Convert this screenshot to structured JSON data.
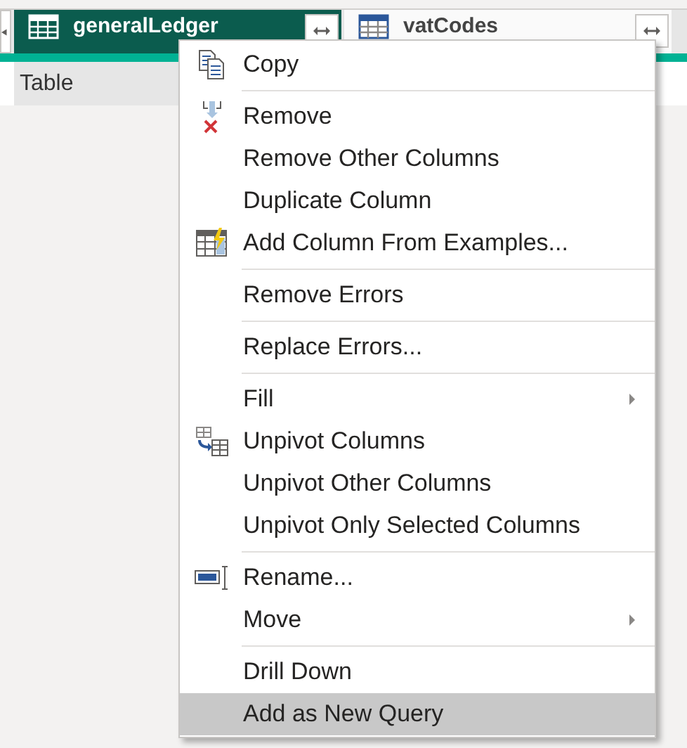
{
  "columns": [
    {
      "title": "generalLedger",
      "selected": true,
      "cell": "Table"
    },
    {
      "title": "vatCodes",
      "selected": false
    }
  ],
  "context_menu": {
    "groups": [
      [
        {
          "label": "Copy",
          "kind": "copy",
          "submenu": false,
          "selected": false
        }
      ],
      [
        {
          "label": "Remove",
          "kind": "remove",
          "submenu": false,
          "selected": false
        },
        {
          "label": "Remove Other Columns",
          "submenu": false,
          "selected": false
        },
        {
          "label": "Duplicate Column",
          "submenu": false,
          "selected": false
        },
        {
          "label": "Add Column From Examples...",
          "kind": "examples",
          "submenu": false,
          "selected": false
        }
      ],
      [
        {
          "label": "Remove Errors",
          "submenu": false,
          "selected": false
        }
      ],
      [
        {
          "label": "Replace Errors...",
          "submenu": false,
          "selected": false
        }
      ],
      [
        {
          "label": "Fill",
          "submenu": true,
          "selected": false
        },
        {
          "label": "Unpivot Columns",
          "kind": "unpivot",
          "submenu": false,
          "selected": false
        },
        {
          "label": "Unpivot Other Columns",
          "submenu": false,
          "selected": false
        },
        {
          "label": "Unpivot Only Selected Columns",
          "submenu": false,
          "selected": false
        }
      ],
      [
        {
          "label": "Rename...",
          "kind": "rename",
          "submenu": false,
          "selected": false
        },
        {
          "label": "Move",
          "submenu": true,
          "selected": false
        }
      ],
      [
        {
          "label": "Drill Down",
          "submenu": false,
          "selected": false
        },
        {
          "label": "Add as New Query",
          "submenu": false,
          "selected": true
        }
      ]
    ]
  }
}
